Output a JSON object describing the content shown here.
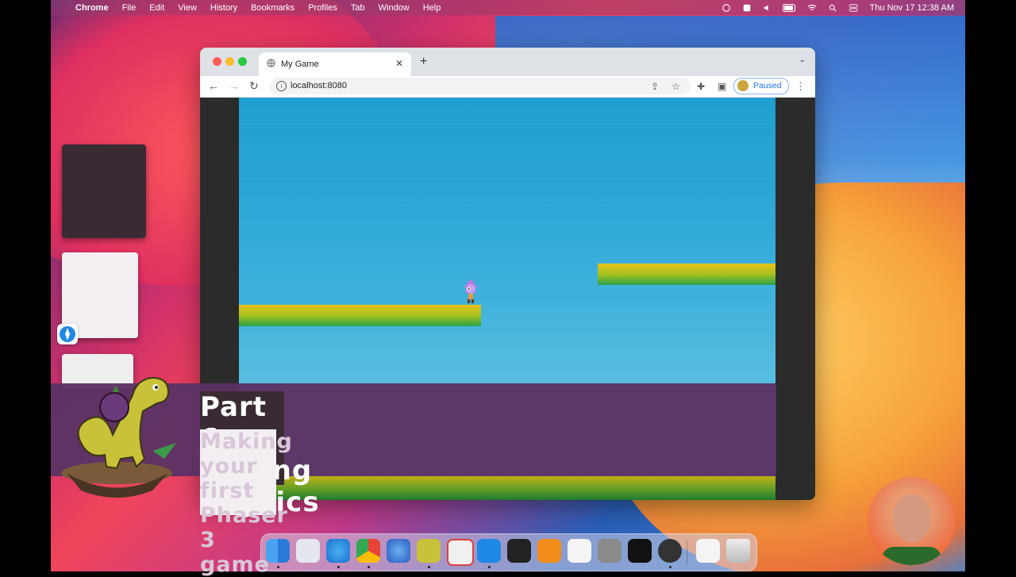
{
  "menubar": {
    "app": "Chrome",
    "items": [
      "File",
      "Edit",
      "View",
      "History",
      "Bookmarks",
      "Profiles",
      "Tab",
      "Window",
      "Help"
    ],
    "clock": "Thu Nov 17  12:38 AM"
  },
  "browser": {
    "tab_title": "My Game",
    "url": "localhost:8080",
    "profile_status": "Paused"
  },
  "game": {
    "sky_top": "#1fa0d0",
    "sky_bottom": "#7ccbe8",
    "platform_colors": [
      "#e8c21a",
      "#2aa04a"
    ]
  },
  "banner": {
    "title": "Part 6: Adding Physics",
    "subtitle": "Making your first Phaser 3 game",
    "bg_color": "#5c3264"
  },
  "dock": {
    "apps": [
      "finder-icon",
      "launchpad-icon",
      "safari-icon",
      "chrome-icon",
      "thunderbird-icon",
      "dino-app-icon",
      "dino-help-icon",
      "vscode-icon",
      "terminal-icon",
      "sublime-text-icon",
      "app-store-icon",
      "system-preferences-icon",
      "activity-monitor-icon",
      "obs-icon",
      "archive-icon",
      "trash-icon"
    ]
  }
}
